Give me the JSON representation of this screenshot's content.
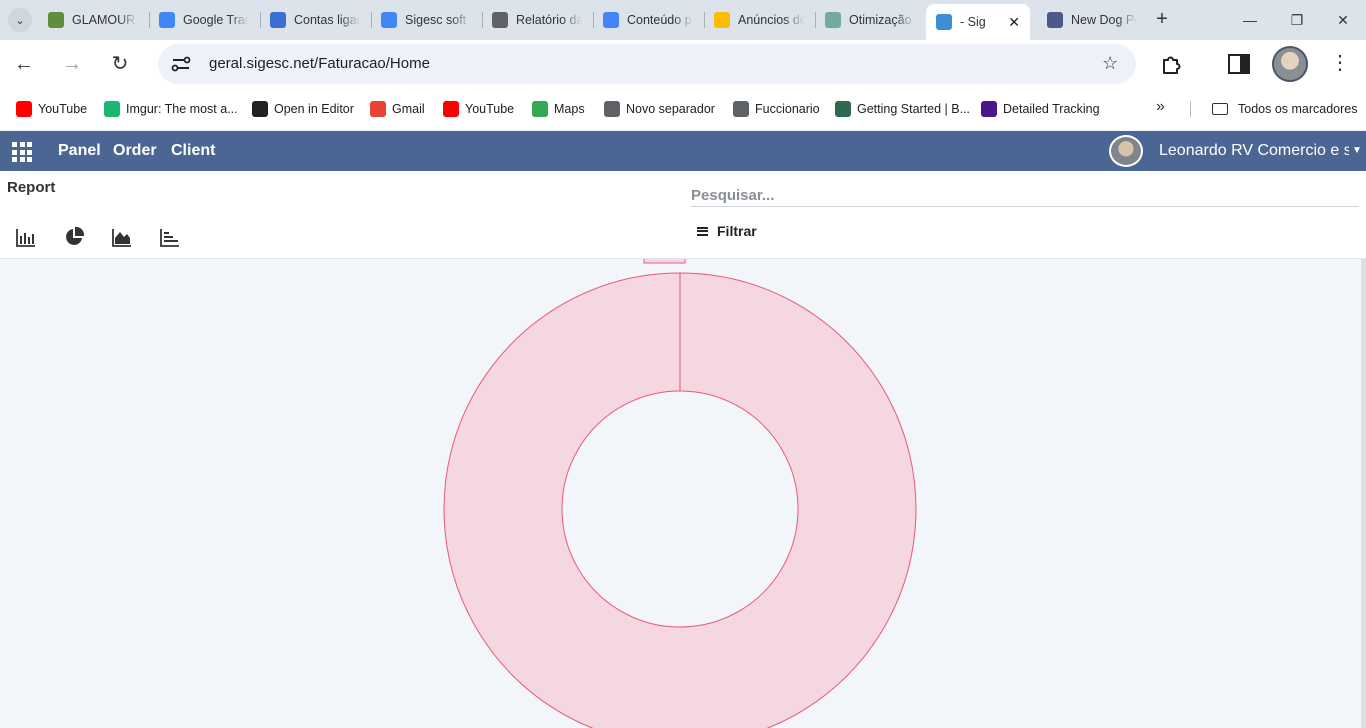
{
  "browser": {
    "tabs": [
      {
        "title": "GLAMOUR C",
        "favicon": "shopify-icon",
        "color": "#5e8e3e"
      },
      {
        "title": "Google Trad",
        "favicon": "google-translate-icon",
        "color": "#4285f4"
      },
      {
        "title": "Contas ligac",
        "favicon": "google-ads-tools-icon",
        "color": "#3b6fd6"
      },
      {
        "title": "Sigesc soft -",
        "favicon": "google-icon",
        "color": "#4285f4"
      },
      {
        "title": "Relatório da",
        "favicon": "report-icon",
        "color": "#5f6368"
      },
      {
        "title": "Conteúdo p",
        "favicon": "google-icon",
        "color": "#4285f4"
      },
      {
        "title": "Anúncios dc",
        "favicon": "google-ads-icon",
        "color": "#fbbc04"
      },
      {
        "title": "Otimização",
        "favicon": "chatgpt-icon",
        "color": "#74aa9c"
      },
      {
        "title": "- Sig",
        "favicon": "sigesc-icon",
        "color": "#3a8fd6",
        "active": true
      },
      {
        "title": "New Dog Pe",
        "favicon": "globe-icon",
        "color": "#4a5a8c"
      }
    ],
    "url": "geral.sigesc.net/Faturacao/Home",
    "bookmarks": [
      {
        "label": "YouTube",
        "icon": "youtube-icon",
        "color": "#ff0000"
      },
      {
        "label": "Imgur: The most a...",
        "icon": "imgur-icon",
        "color": "#1bb76e"
      },
      {
        "label": "Open in Editor",
        "icon": "codepen-icon",
        "color": "#222222"
      },
      {
        "label": "Gmail",
        "icon": "gmail-icon",
        "color": "#ea4335"
      },
      {
        "label": "YouTube",
        "icon": "youtube-icon",
        "color": "#ff0000"
      },
      {
        "label": "Maps",
        "icon": "maps-icon",
        "color": "#34a853"
      },
      {
        "label": "Novo separador",
        "icon": "chrome-icon",
        "color": "#5f6368"
      },
      {
        "label": "Fuccionario",
        "icon": "chrome-icon",
        "color": "#5f6368"
      },
      {
        "label": "Getting Started | B...",
        "icon": "bootstrap-icon",
        "color": "#2d6a4f"
      },
      {
        "label": "Detailed Tracking",
        "icon": "fedex-icon",
        "color": "#4d148c"
      }
    ],
    "all_bookmarks_label": "Todos os marcadores"
  },
  "app": {
    "nav": [
      "Panel",
      "Order",
      "Client"
    ],
    "user_name": "Leonardo RV Comercio e se"
  },
  "report": {
    "title": "Report",
    "chart_types": [
      "bar-chart-icon",
      "pie-chart-icon",
      "area-chart-icon",
      "stacked-bar-icon"
    ],
    "search_placeholder": "Pesquisar...",
    "filter_label": "Filtrar"
  },
  "chart_data": {
    "type": "pie",
    "style": "doughnut",
    "slices": [
      {
        "label": "",
        "value": 100,
        "color": "#f5d7e1",
        "border": "#e8597a"
      }
    ]
  }
}
